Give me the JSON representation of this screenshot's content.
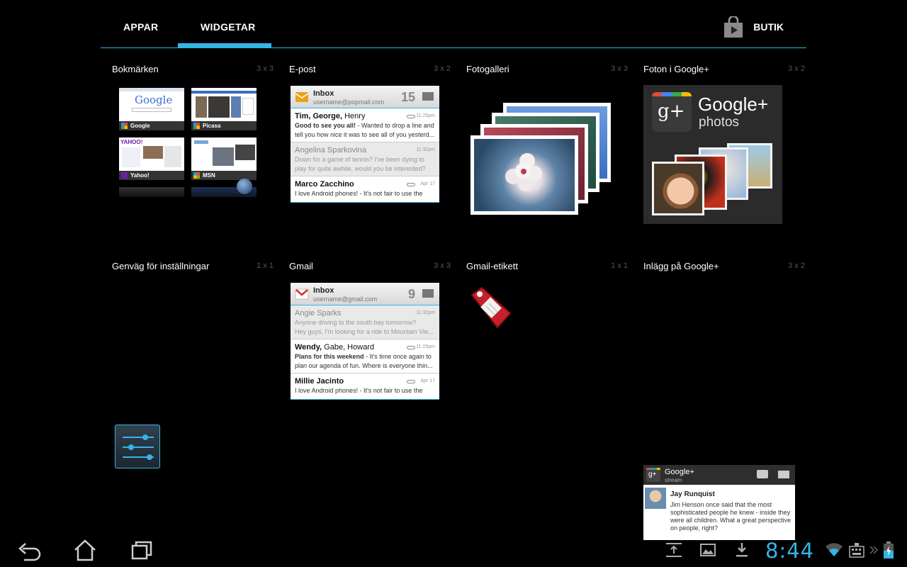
{
  "tabs": {
    "apps_label": "APPAR",
    "widgets_label": "WIDGETAR",
    "shop_label": "BUTIK",
    "accent_color": "#33b5e5"
  },
  "widgets": [
    {
      "title": "Bokmärken",
      "size": "3 x 3"
    },
    {
      "title": "E-post",
      "size": "3 x 2"
    },
    {
      "title": "Fotogalleri",
      "size": "3 x 3"
    },
    {
      "title": "Foton i Google+",
      "size": "3 x 2"
    },
    {
      "title": "Genväg för inställningar",
      "size": "1 x 1"
    },
    {
      "title": "Gmail",
      "size": "3 x 3"
    },
    {
      "title": "Gmail-etikett",
      "size": "1 x 1"
    },
    {
      "title": "Inlägg på Google+",
      "size": "3 x 2"
    }
  ],
  "bookmarks": {
    "tiles": [
      "Google",
      "Picasa",
      "Yahoo!",
      "MSN"
    ],
    "logo_text": "Google"
  },
  "email_preview": {
    "title": "Inbox",
    "account": "username@popmail.com",
    "count": "15",
    "rows": [
      {
        "from_bold": "Tim, George,",
        "from_rest": " Henry",
        "time": "11:25pm",
        "line1_bold": "Good to see you all!",
        "line1_rest": " - Wanted to drop a line and",
        "line2": "tell you how nice it was to see all of you yesterd..."
      },
      {
        "from_bold": "",
        "from_rest": "Angelina Sparkovina",
        "time": "11:32pm",
        "line1_bold": "",
        "line1_rest": "Down for a game of tennis? I've been dying to",
        "line2": "play for quite awhile, would you be interested?"
      },
      {
        "from_bold": "Marco Zacchino",
        "from_rest": "",
        "time": "Apr 17",
        "line1_bold": "",
        "line1_rest": "I love Android phones! -  It's not fair to use the",
        "line2": ""
      }
    ]
  },
  "gmail_preview": {
    "title": "Inbox",
    "account": "username@gmail.com",
    "count": "9",
    "rows": [
      {
        "from_bold": "",
        "from_rest": "Angie Sparks",
        "time": "11:32pm",
        "line1_bold": "",
        "line1_rest": "Anyone driving to the south bay tomorrow?",
        "line2": "Hey guys, I'm looking for a ride to Mountain Vie..."
      },
      {
        "from_bold": "Wendy,",
        "from_rest": " Gabe, Howard",
        "time": "11:29pm",
        "line1_bold": "Plans for this weekend",
        "line1_rest": " - It's time once again to",
        "line2": "plan our agenda of fun. Where is everyone thin..."
      },
      {
        "from_bold": "Millie Jacinto",
        "from_rest": "",
        "time": "Apr 17",
        "line1_bold": "",
        "line1_rest": "I love Android phones! -  It's not fair to use the",
        "line2": ""
      }
    ]
  },
  "gplus_photos": {
    "brand": "Google+",
    "sub": "photos",
    "badge": "g+"
  },
  "gplus_stream": {
    "badge": "g+",
    "brand": "Google+",
    "sub": "stream",
    "author": "Jay Runquist",
    "text_lines": [
      "Jim Henson once said that the most",
      "sophisticated people he knew - inside they",
      "were all children. What a great perspective",
      "on people, right?"
    ]
  },
  "status": {
    "clock": "8:44"
  }
}
